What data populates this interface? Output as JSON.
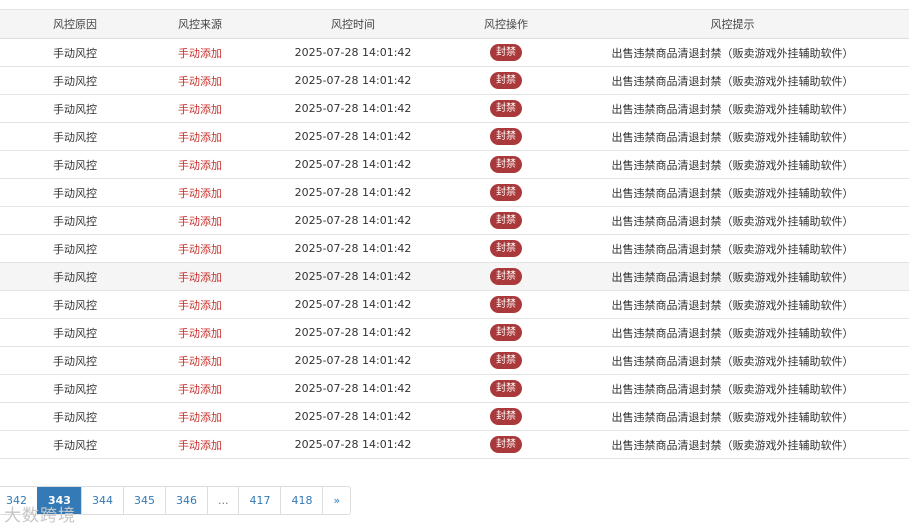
{
  "table": {
    "headers": [
      "风控原因",
      "风控来源",
      "风控时间",
      "风控操作",
      "风控提示"
    ],
    "rows": [
      {
        "reason": "手动风控",
        "source": "手动添加",
        "time": "2025-07-28 14:01:42",
        "action": "封禁",
        "hint": "出售违禁商品清退封禁（贩卖游戏外挂辅助软件）"
      },
      {
        "reason": "手动风控",
        "source": "手动添加",
        "time": "2025-07-28 14:01:42",
        "action": "封禁",
        "hint": "出售违禁商品清退封禁（贩卖游戏外挂辅助软件）"
      },
      {
        "reason": "手动风控",
        "source": "手动添加",
        "time": "2025-07-28 14:01:42",
        "action": "封禁",
        "hint": "出售违禁商品清退封禁（贩卖游戏外挂辅助软件）"
      },
      {
        "reason": "手动风控",
        "source": "手动添加",
        "time": "2025-07-28 14:01:42",
        "action": "封禁",
        "hint": "出售违禁商品清退封禁（贩卖游戏外挂辅助软件）"
      },
      {
        "reason": "手动风控",
        "source": "手动添加",
        "time": "2025-07-28 14:01:42",
        "action": "封禁",
        "hint": "出售违禁商品清退封禁（贩卖游戏外挂辅助软件）"
      },
      {
        "reason": "手动风控",
        "source": "手动添加",
        "time": "2025-07-28 14:01:42",
        "action": "封禁",
        "hint": "出售违禁商品清退封禁（贩卖游戏外挂辅助软件）"
      },
      {
        "reason": "手动风控",
        "source": "手动添加",
        "time": "2025-07-28 14:01:42",
        "action": "封禁",
        "hint": "出售违禁商品清退封禁（贩卖游戏外挂辅助软件）"
      },
      {
        "reason": "手动风控",
        "source": "手动添加",
        "time": "2025-07-28 14:01:42",
        "action": "封禁",
        "hint": "出售违禁商品清退封禁（贩卖游戏外挂辅助软件）"
      },
      {
        "reason": "手动风控",
        "source": "手动添加",
        "time": "2025-07-28 14:01:42",
        "action": "封禁",
        "hint": "出售违禁商品清退封禁（贩卖游戏外挂辅助软件）",
        "highlighted": true
      },
      {
        "reason": "手动风控",
        "source": "手动添加",
        "time": "2025-07-28 14:01:42",
        "action": "封禁",
        "hint": "出售违禁商品清退封禁（贩卖游戏外挂辅助软件）"
      },
      {
        "reason": "手动风控",
        "source": "手动添加",
        "time": "2025-07-28 14:01:42",
        "action": "封禁",
        "hint": "出售违禁商品清退封禁（贩卖游戏外挂辅助软件）"
      },
      {
        "reason": "手动风控",
        "source": "手动添加",
        "time": "2025-07-28 14:01:42",
        "action": "封禁",
        "hint": "出售违禁商品清退封禁（贩卖游戏外挂辅助软件）"
      },
      {
        "reason": "手动风控",
        "source": "手动添加",
        "time": "2025-07-28 14:01:42",
        "action": "封禁",
        "hint": "出售违禁商品清退封禁（贩卖游戏外挂辅助软件）"
      },
      {
        "reason": "手动风控",
        "source": "手动添加",
        "time": "2025-07-28 14:01:42",
        "action": "封禁",
        "hint": "出售违禁商品清退封禁（贩卖游戏外挂辅助软件）"
      },
      {
        "reason": "手动风控",
        "source": "手动添加",
        "time": "2025-07-28 14:01:42",
        "action": "封禁",
        "hint": "出售违禁商品清退封禁（贩卖游戏外挂辅助软件）"
      }
    ]
  },
  "pagination": {
    "pages": [
      "342",
      "343",
      "344",
      "345",
      "346",
      "...",
      "417",
      "418",
      "»"
    ],
    "active": "343"
  },
  "watermark": "大数跨境",
  "colors": {
    "source_text": "#c9302c",
    "action_badge": "#a9393b",
    "pagination_active": "#337ab7",
    "header_bg": "#f5f5f5"
  }
}
